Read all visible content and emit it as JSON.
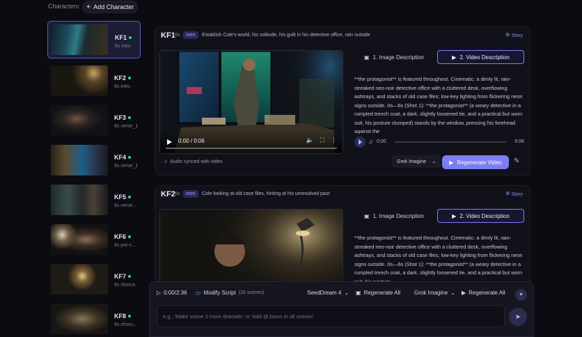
{
  "topbar": {
    "characters_label": "Characters:",
    "add_character_label": "Add Character"
  },
  "sidebar": {
    "items": [
      {
        "kf": "KF1",
        "meta": "6s intro"
      },
      {
        "kf": "KF2",
        "meta": "6s intro"
      },
      {
        "kf": "KF3",
        "meta": "6s verse_1"
      },
      {
        "kf": "KF4",
        "meta": "6s verse_1"
      },
      {
        "kf": "KF5",
        "meta": "6s verse..."
      },
      {
        "kf": "KF6",
        "meta": "6s pre-c..."
      },
      {
        "kf": "KF7",
        "meta": "6s chorus"
      },
      {
        "kf": "KF8",
        "meta": "6s choru..."
      }
    ]
  },
  "panels": [
    {
      "kf": "KF1",
      "duration": "6s",
      "tag": "intro",
      "description": "Establish Cole's world, his solitude, his guilt in his detective office, rain outside",
      "story_label": "Story",
      "video_time": "0:00 / 0:06",
      "tab1": "1. Image Description",
      "tab2": "2. Video Description",
      "desc_text": "**the protagonist** is featured throughout. Cinematic: a dimly lit, rain-streaked neo-noir detective office with a cluttered desk, overflowing ashtrays, and stacks of old case files; low-key lighting from flickering neon signs outside. 0s—6s (Shot 1): **the protagonist** (a weary detective in a rumpled trench coat, a dark, slightly loosened tie, and a practical but worn suit, his posture slumped) stands by the window, pressing his forehead against the",
      "audio_start": "0:00",
      "audio_end": "0:06",
      "audio_note": "Audio synced with video",
      "model": "Grok Imagine",
      "regen_label": "Regenerate Video"
    },
    {
      "kf": "KF2",
      "duration": "6s",
      "tag": "intro",
      "description": "Cole looking at old case files, hinting at his unresolved past",
      "story_label": "Story",
      "tab1": "1. Image Description",
      "tab2": "2. Video Description",
      "desc_text": "**the protagonist** is featured throughout. Cinematic: a dimly lit, rain-streaked neo-noir detective office with a cluttered desk, overflowing ashtrays, and stacks of old case files; low-key lighting from flickering neon signs outside. 0s—6s (Shot 1): **the protagonist** (a weary detective in a rumpled trench coat, a dark, slightly loosened tie, and a practical but worn suit, his posture"
    }
  ],
  "bottombar": {
    "time": "0:00/2:36",
    "modify_label": "Modify Script",
    "scenes": "(26 scenes)",
    "image_model": "SeedDream 4",
    "regen_all_label": "Regenerate All",
    "video_model": "Grok Imagine",
    "regen_all_label_2": "Regenerate All",
    "input_placeholder": "e.g., 'Make scene 2 more dramatic' or 'Add @Jason to all scenes'"
  },
  "colors": {
    "accent": "#7b7ef2",
    "status_green": "#3fd37a",
    "background": "#0b0b12"
  }
}
